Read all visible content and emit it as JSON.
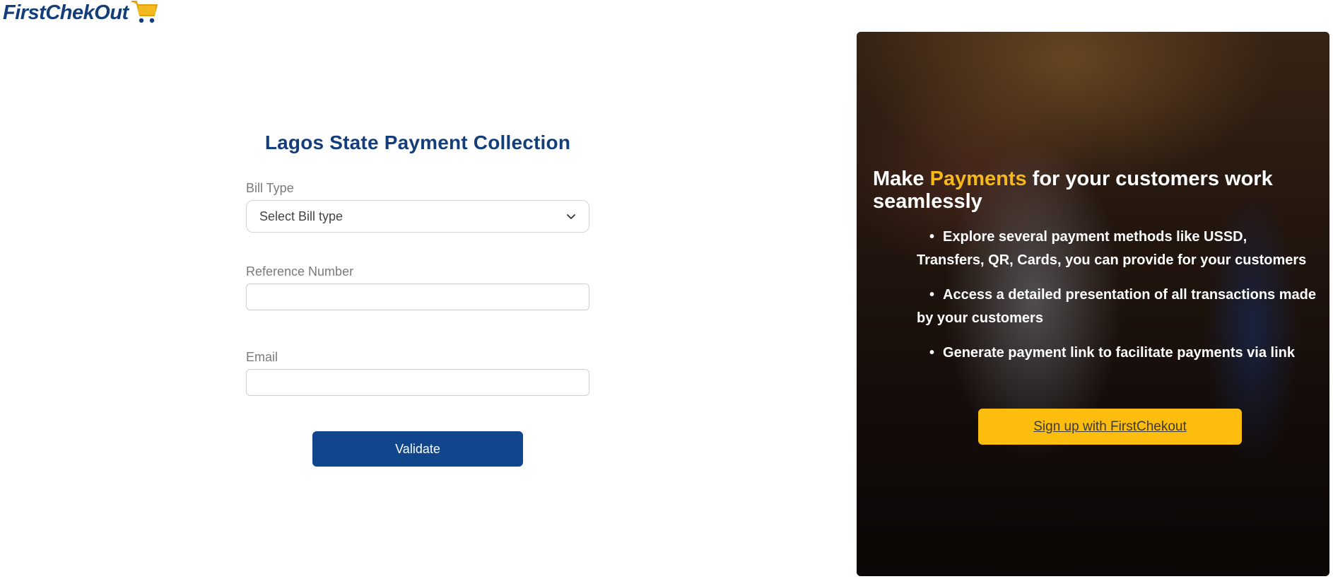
{
  "brand": {
    "logo_text": "FirstChekOut",
    "cart_icon": "shopping-cart-icon",
    "colors": {
      "primary": "#143e7a",
      "accent": "#f6b81a"
    }
  },
  "form": {
    "title": "Lagos State Payment Collection",
    "bill_type_label": "Bill Type",
    "bill_type_selected": "Select Bill type",
    "reference_label": "Reference Number",
    "reference_value": "",
    "email_label": "Email",
    "email_value": "",
    "validate_label": "Validate"
  },
  "promo": {
    "heading_prefix": "Make ",
    "heading_highlight": "Payments",
    "heading_suffix": " for your customers work seamlessly",
    "bullets": [
      "Explore several payment methods like USSD, Transfers, QR, Cards, you can provide for your customers",
      "Access a detailed presentation of all transactions made by your customers",
      "Generate payment link to facilitate payments via link"
    ],
    "bullet_glyph": "•",
    "signup_label": "Sign up with FirstChekout"
  }
}
